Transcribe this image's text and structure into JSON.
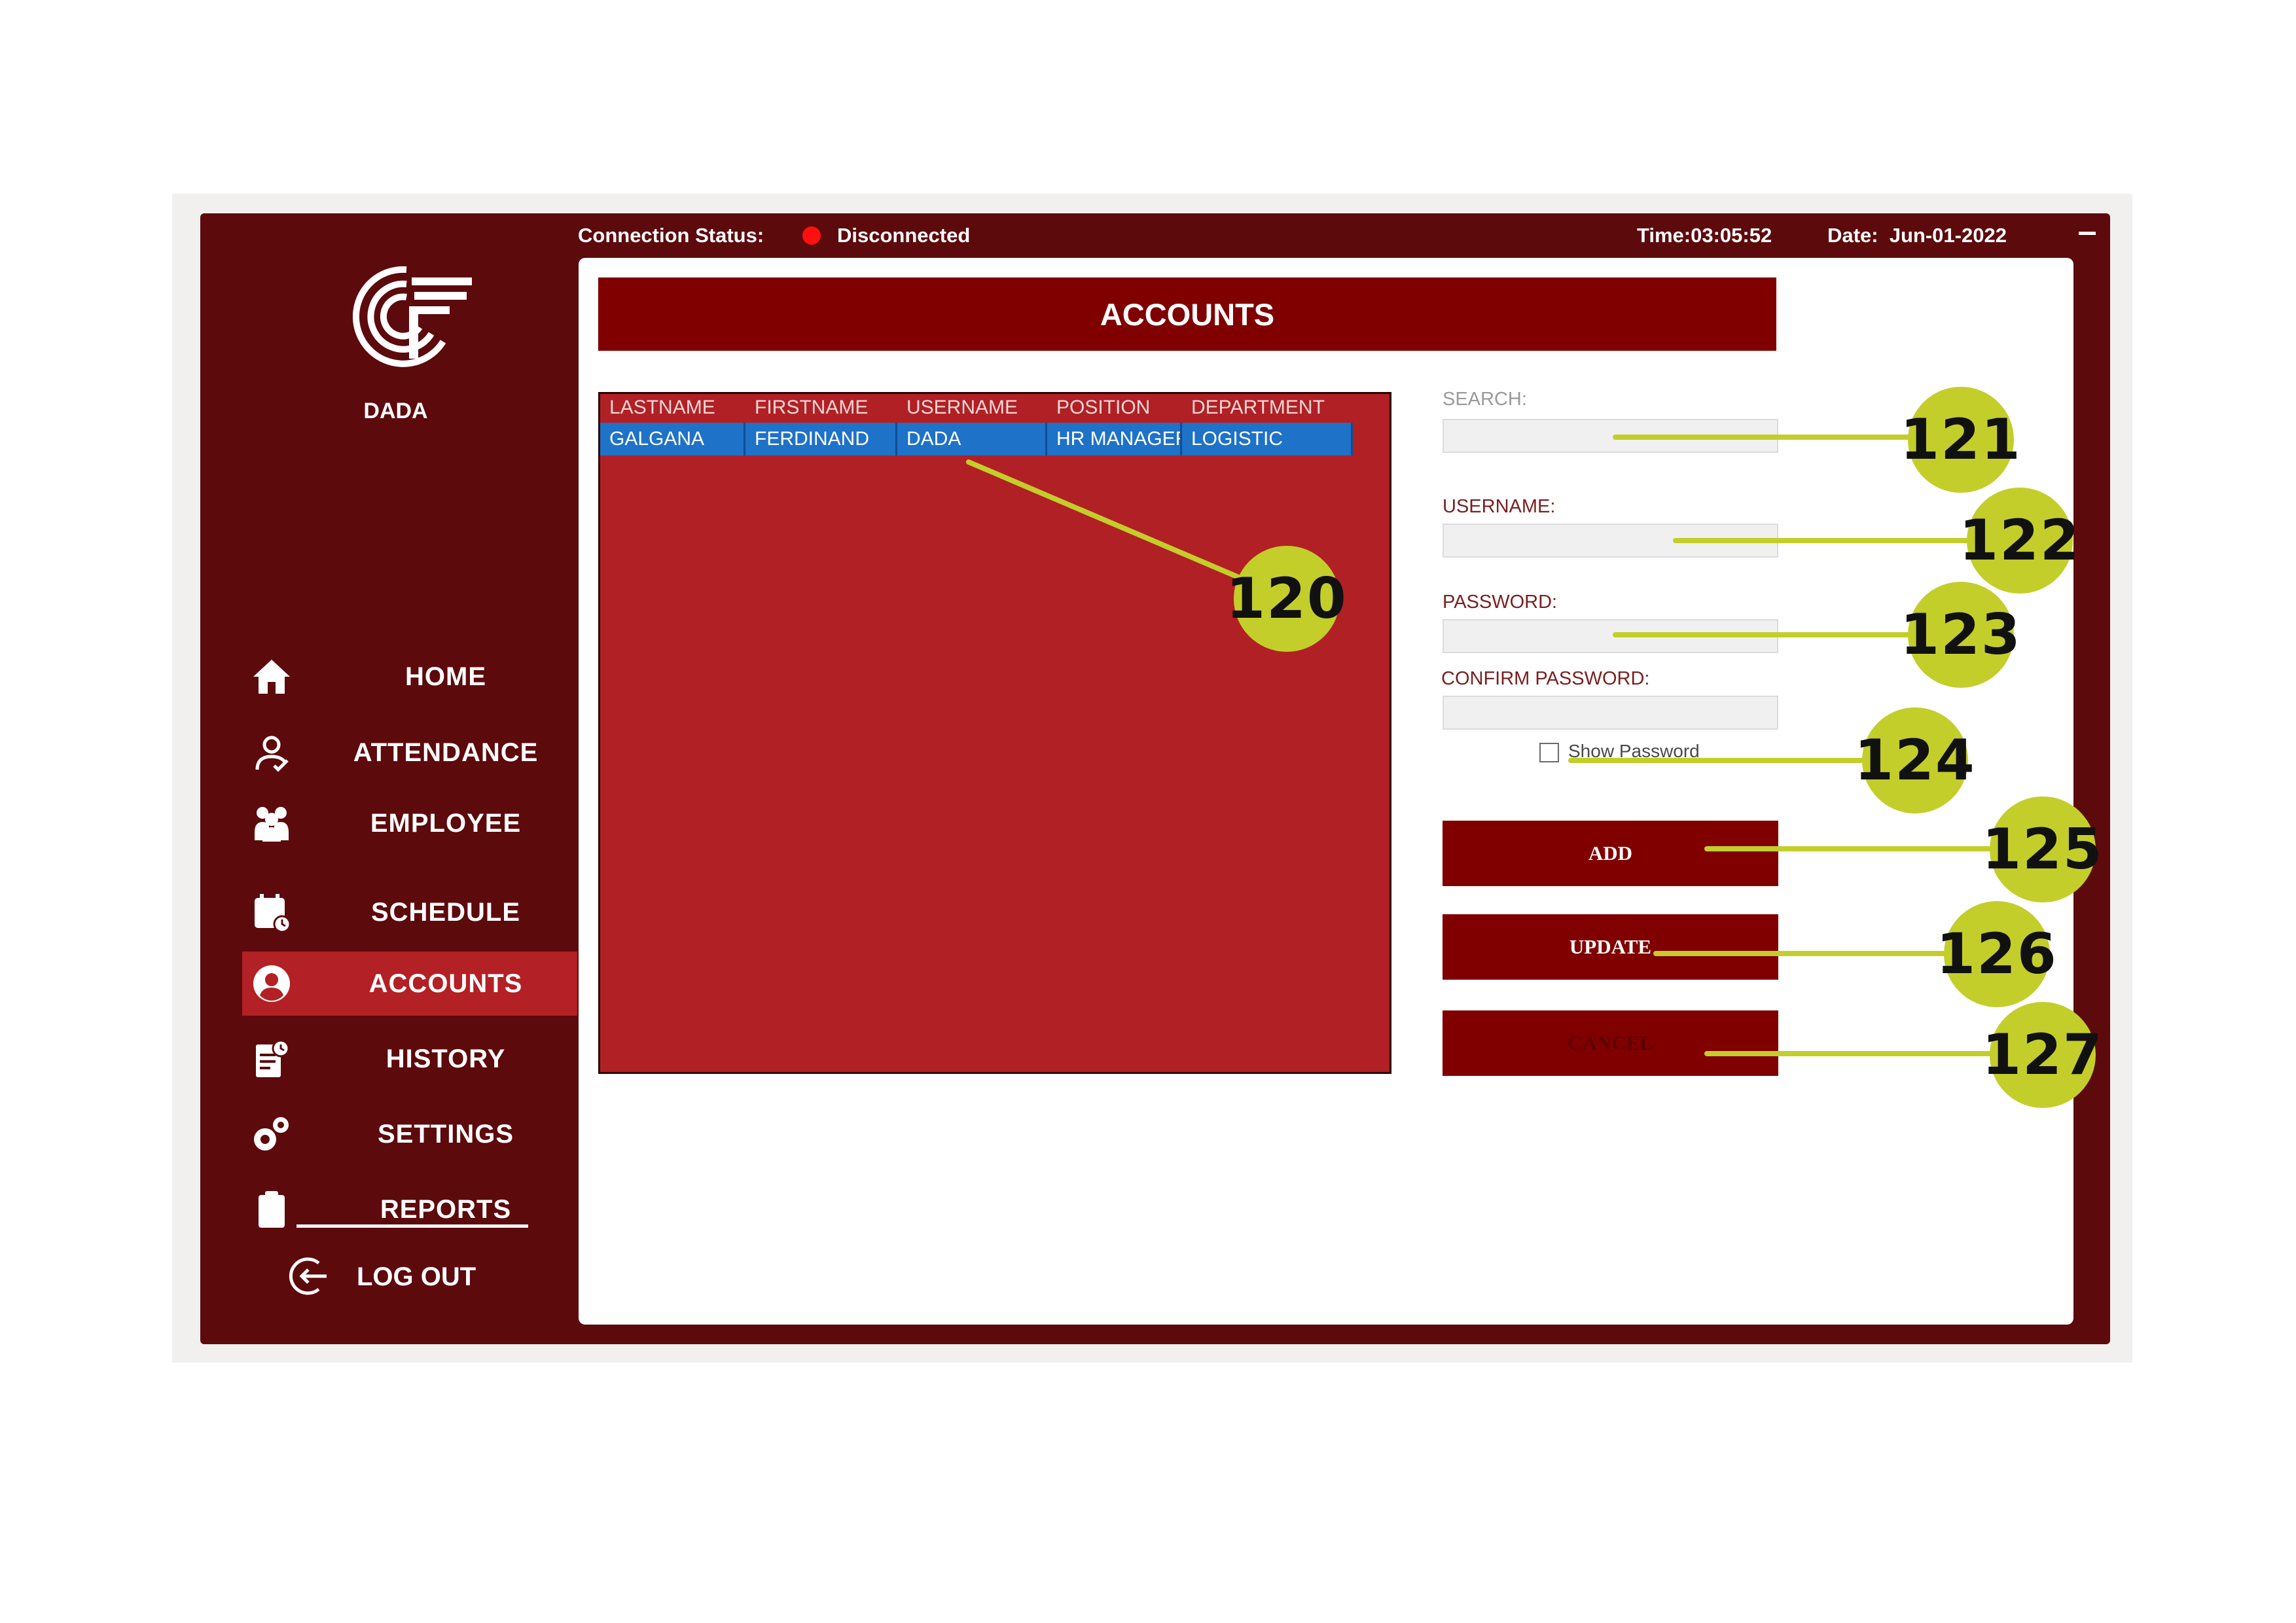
{
  "status_bar": {
    "connection_label": "Connection Status:",
    "connection_value": "Disconnected",
    "time": "Time:03:05:52",
    "date": "Date:  Jun-01-2022"
  },
  "sidebar": {
    "user": "DADA",
    "items": [
      {
        "label": "HOME",
        "icon": "home-icon"
      },
      {
        "label": "ATTENDANCE",
        "icon": "attendance-icon"
      },
      {
        "label": "EMPLOYEE",
        "icon": "employee-icon"
      },
      {
        "label": "SCHEDULE",
        "icon": "schedule-icon"
      },
      {
        "label": "ACCOUNTS",
        "icon": "accounts-icon",
        "active": true
      },
      {
        "label": "HISTORY",
        "icon": "history-icon"
      },
      {
        "label": "SETTINGS",
        "icon": "settings-icon"
      },
      {
        "label": "REPORTS",
        "icon": "reports-icon"
      }
    ],
    "logout": "LOG OUT"
  },
  "main": {
    "title": "ACCOUNTS",
    "table": {
      "columns": [
        "LASTNAME",
        "FIRSTNAME",
        "USERNAME",
        "POSITION",
        "DEPARTMENT"
      ],
      "rows": [
        [
          "GALGANA",
          "FERDINAND",
          "DADA",
          "HR MANAGER",
          "LOGISTIC"
        ]
      ]
    },
    "form": {
      "search_label": "SEARCH:",
      "username_label": "USERNAME:",
      "password_label": "PASSWORD:",
      "confirm_label": "CONFIRM PASSWORD:",
      "show_password": "Show Password",
      "add": "ADD",
      "update": "UPDATE",
      "cancel": "CANCEL"
    }
  },
  "callouts": [
    "120",
    "121",
    "122",
    "123",
    "124",
    "125",
    "126",
    "127"
  ],
  "colors": {
    "app_background": "#5d0a0d",
    "accent": "#800000",
    "table_background": "#b12024",
    "selected_row": "#1e72c8",
    "callout": "#c3ce2b"
  }
}
